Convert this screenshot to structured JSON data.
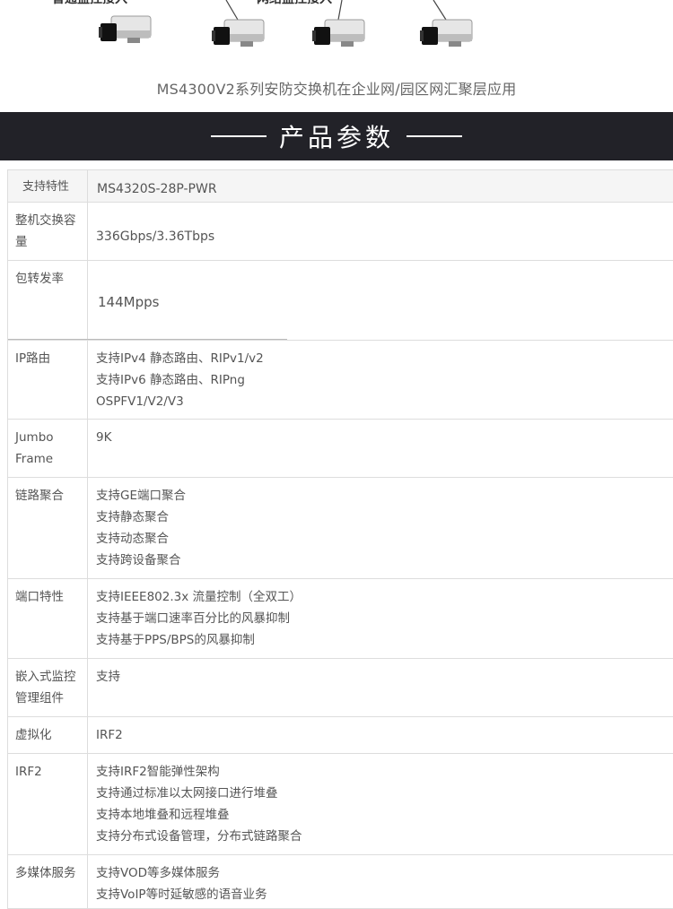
{
  "diagram": {
    "cut_labels": [
      "普通监控接入",
      "网络监控接入"
    ],
    "cameras": [
      "camera-1",
      "camera-2",
      "camera-3",
      "camera-4"
    ],
    "caption": "MS4300V2系列安防交换机在企业网/园区网汇聚层应用"
  },
  "banner": {
    "title": "产品参数"
  },
  "specs": [
    {
      "key": "支持特性",
      "lines": [
        "MS4320S-28P-PWR"
      ]
    },
    {
      "key": "整机交换容量",
      "lines": [
        "336Gbps/3.36Tbps"
      ]
    },
    {
      "key": "包转发率",
      "lines": [
        "144Mpps"
      ]
    },
    {
      "key": "IP路由",
      "lines": [
        "支持IPv4 静态路由、RIPv1/v2",
        "支持IPv6 静态路由、RIPng",
        "OSPFV1/V2/V3"
      ]
    },
    {
      "key": "Jumbo Frame",
      "lines": [
        "9K"
      ]
    },
    {
      "key": "链路聚合",
      "lines": [
        "支持GE端口聚合",
        "支持静态聚合",
        "支持动态聚合",
        "支持跨设备聚合"
      ]
    },
    {
      "key": "端口特性",
      "lines": [
        "支持IEEE802.3x 流量控制（全双工）",
        "支持基于端口速率百分比的风暴抑制",
        "支持基于PPS/BPS的风暴抑制"
      ]
    },
    {
      "key": "嵌入式监控管理组件",
      "lines": [
        "支持"
      ]
    },
    {
      "key": "虚拟化",
      "lines": [
        "IRF2"
      ]
    },
    {
      "key": "IRF2",
      "lines": [
        "支持IRF2智能弹性架构",
        "支持通过标准以太网接口进行堆叠",
        "支持本地堆叠和远程堆叠",
        "支持分布式设备管理，分布式链路聚合"
      ]
    },
    {
      "key": "多媒体服务",
      "lines": [
        "支持VOD等多媒体服务",
        "支持VoIP等时延敏感的语音业务"
      ]
    }
  ]
}
